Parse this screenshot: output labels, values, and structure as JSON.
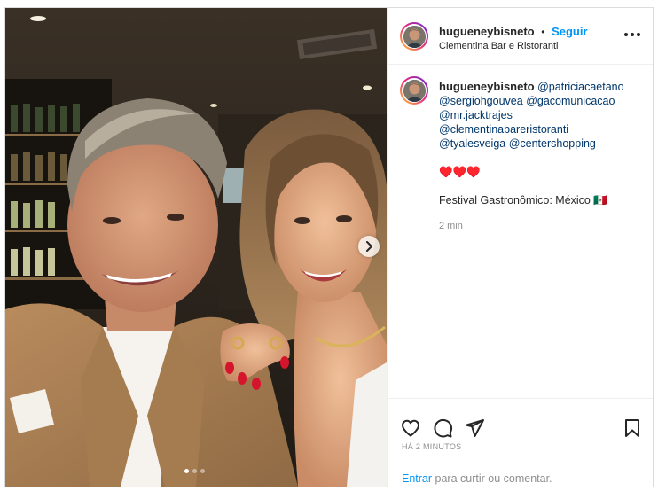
{
  "post": {
    "username": "hugueneybisneto",
    "separator": "•",
    "follow_label": "Seguir",
    "location": "Clementina Bar e Ristoranti",
    "more_icon": "more-horizontal-icon"
  },
  "caption": {
    "username": "hugueneybisneto",
    "mentions": [
      "@patriciacaetano",
      "@sergiohgouvea",
      "@gacomunicacao",
      "@mr.jacktrajes",
      "@clementinabareristoranti",
      "@tyalesveiga",
      "@centershopping"
    ],
    "hearts_line": "♥️♥️♥️",
    "text": "Festival Gastronômico: México 🇲🇽",
    "relative_time": "2 min"
  },
  "carousel": {
    "dots": 3,
    "active_index": 0,
    "next_icon": "chevron-right-icon"
  },
  "actions": {
    "like_icon": "heart-icon",
    "comment_icon": "comment-icon",
    "share_icon": "send-icon",
    "save_icon": "bookmark-icon",
    "timestamp": "HÁ 2 MINUTOS"
  },
  "login_prompt": {
    "login_link": "Entrar",
    "rest": " para curtir ou comentar."
  }
}
